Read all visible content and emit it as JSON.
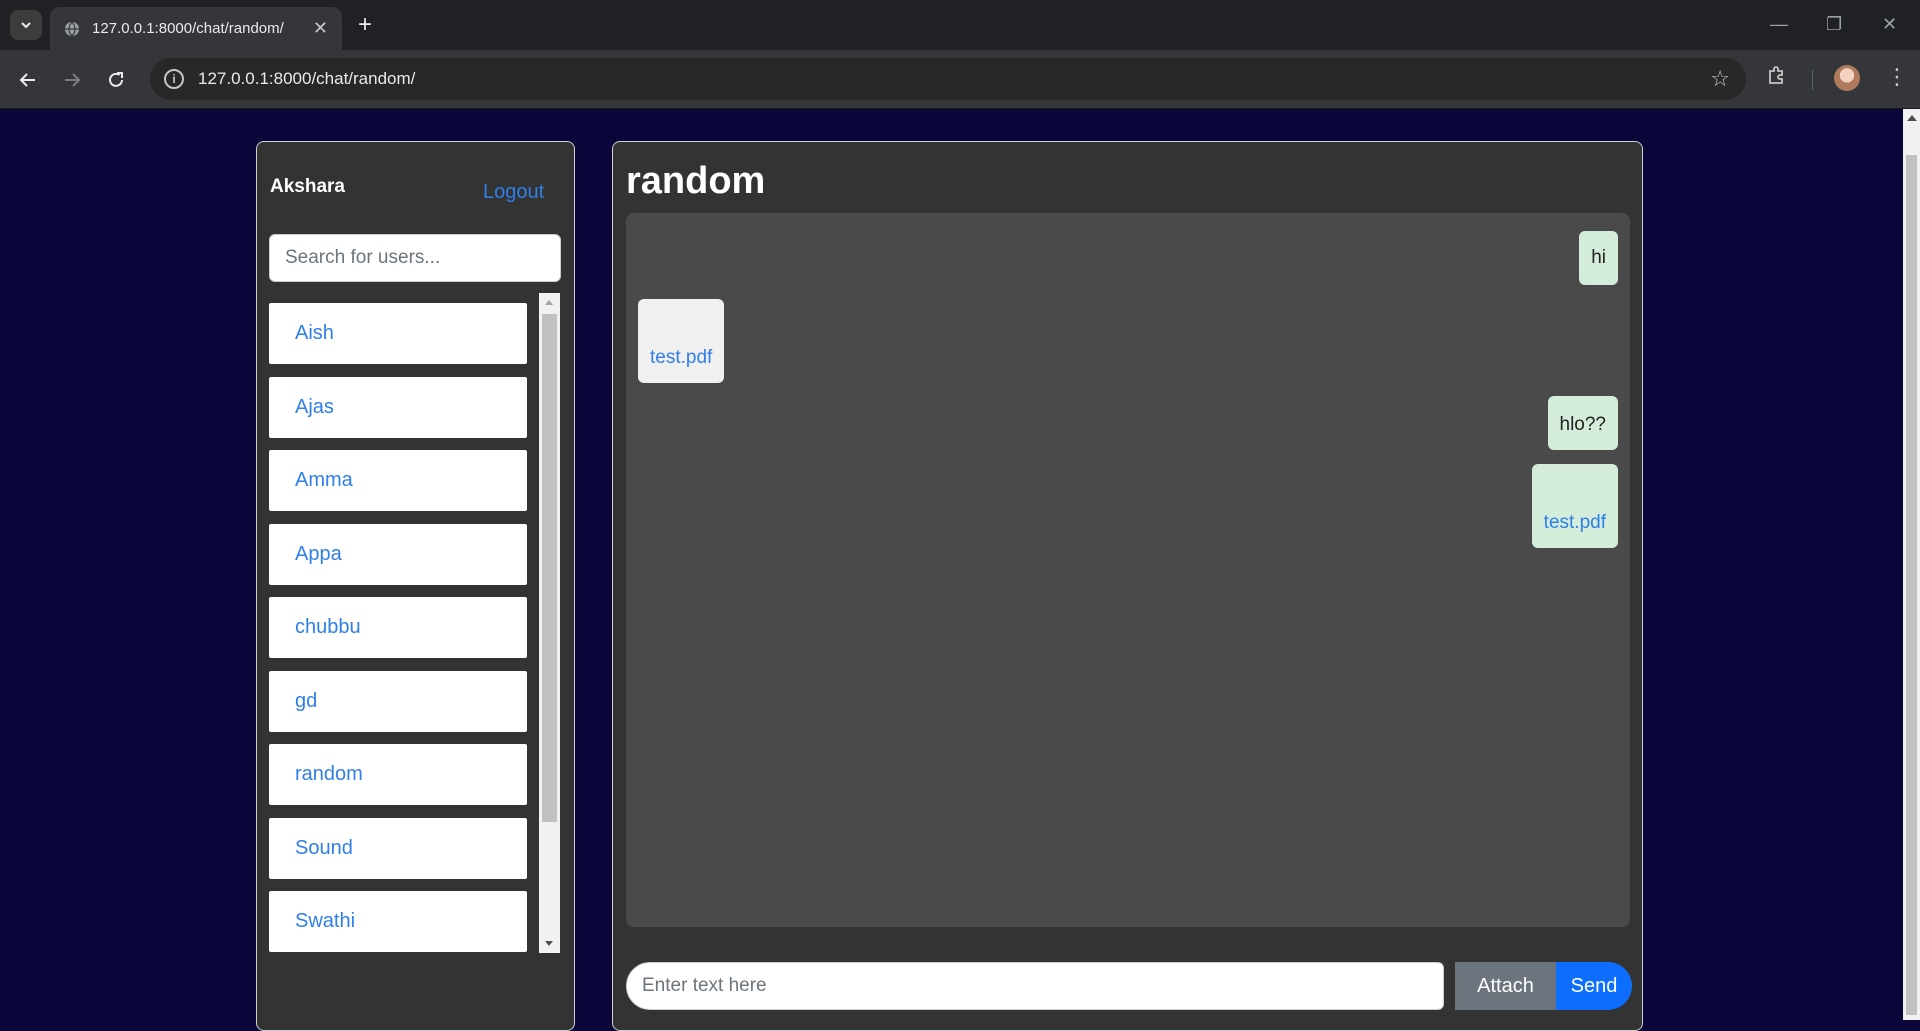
{
  "browser": {
    "tab_title": "127.0.0.1:8000/chat/random/",
    "url": "127.0.0.1:8000/chat/random/"
  },
  "sidebar": {
    "current_user": "Akshara",
    "logout_label": "Logout",
    "search_placeholder": "Search for users...",
    "users": [
      "Aish",
      "Ajas",
      "Amma",
      "Appa",
      "chubbu",
      "gd",
      "random",
      "Sound",
      "Swathi"
    ]
  },
  "chat": {
    "title": "random",
    "messages": [
      {
        "direction": "out",
        "text": "hi",
        "is_file": false
      },
      {
        "direction": "in",
        "text": "test.pdf",
        "is_file": true
      },
      {
        "direction": "out",
        "text": "hlo??",
        "is_file": false
      },
      {
        "direction": "out",
        "text": "test.pdf",
        "is_file": true
      }
    ],
    "input_placeholder": "Enter text here",
    "attach_label": "Attach",
    "send_label": "Send"
  },
  "colors": {
    "page_bg": "#0a0639",
    "panel_bg": "#333333",
    "messages_bg": "#4a4a4a",
    "link": "#2f7fe8",
    "out_bubble": "#d4edda",
    "in_bubble": "#f0f0f0",
    "send": "#0d6efd",
    "attach": "#6c757d"
  }
}
